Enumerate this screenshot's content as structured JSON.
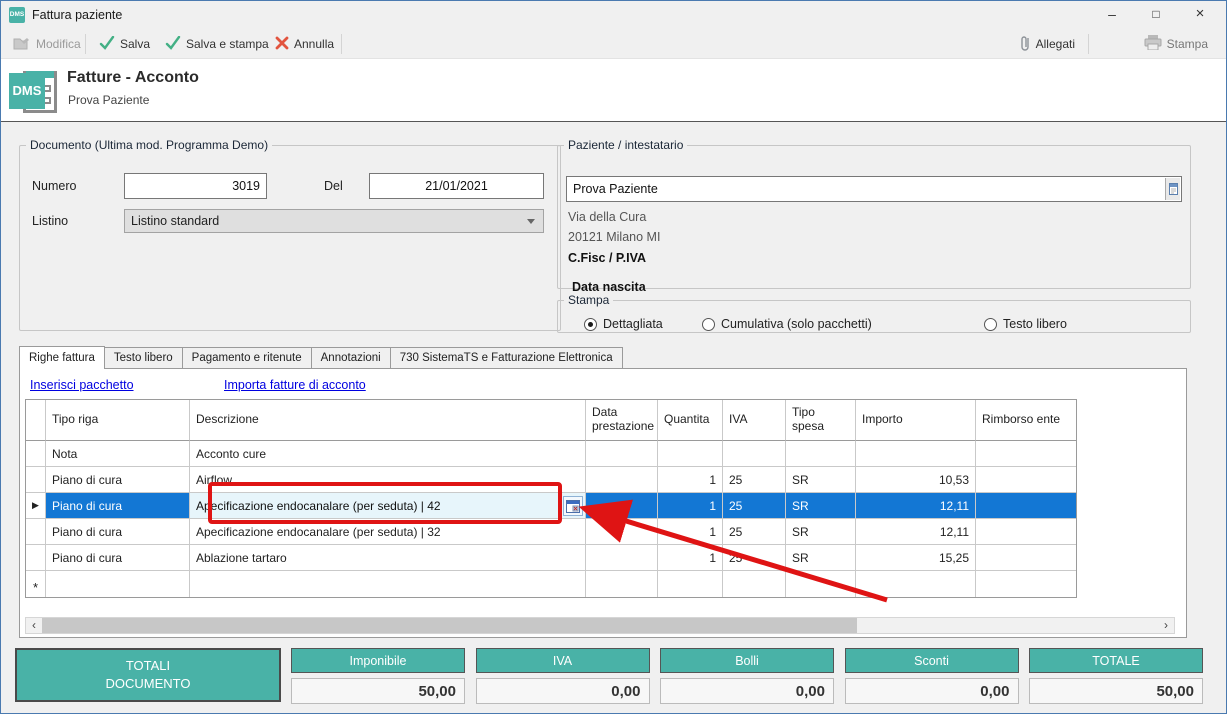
{
  "window": {
    "title": "Fattura paziente",
    "controls": {
      "minimize": "–",
      "maximize": "□",
      "close": "×"
    }
  },
  "toolbar": {
    "modifica": "Modifica",
    "salva": "Salva",
    "salva_e_stampa": "Salva e stampa",
    "annulla": "Annulla",
    "allegati": "Allegati",
    "stampa": "Stampa"
  },
  "header": {
    "logo_text": "DMS",
    "title": "Fatture - Acconto",
    "subtitle": "Prova Paziente"
  },
  "documento": {
    "legend": "Documento (Ultima mod. Programma Demo)",
    "numero_label": "Numero",
    "numero_value": "3019",
    "del_label": "Del",
    "del_value": "21/01/2021",
    "listino_label": "Listino",
    "listino_value": "Listino standard"
  },
  "paziente": {
    "legend": "Paziente / intestatario",
    "nome": "Prova Paziente",
    "indirizzo": "Via della Cura",
    "citta": "20121 Milano MI",
    "cfisc": "C.Fisc / P.IVA",
    "data_nascita": "Data nascita"
  },
  "stampa_group": {
    "legend": "Stampa",
    "options": [
      {
        "label": "Dettagliata",
        "selected": true
      },
      {
        "label": "Cumulativa (solo pacchetti)",
        "selected": false
      },
      {
        "label": "Testo libero",
        "selected": false
      }
    ]
  },
  "tabs": {
    "active_index": 0,
    "items": [
      {
        "label": "Righe fattura"
      },
      {
        "label": "Testo libero"
      },
      {
        "label": "Pagamento e ritenute"
      },
      {
        "label": "Annotazioni"
      },
      {
        "label": "730 SistemaTS e Fatturazione Elettronica"
      }
    ]
  },
  "links": {
    "inserisci": "Inserisci pacchetto",
    "importa": "Importa fatture di acconto"
  },
  "table": {
    "columns": [
      "",
      "Tipo riga",
      "Descrizione",
      "Data prestazione",
      "Quantita",
      "IVA",
      "Tipo spesa",
      "Importo",
      "Rimborso ente"
    ],
    "rows": [
      {
        "selector": "",
        "tipo_riga": "Nota",
        "descrizione": "Acconto cure",
        "data_prestazione": "",
        "quantita": "",
        "iva": "",
        "tipo_spesa": "",
        "importo": "",
        "rimborso_ente": "",
        "state": "normal"
      },
      {
        "selector": "",
        "tipo_riga": "Piano di cura",
        "descrizione": "Airflow",
        "data_prestazione": "",
        "quantita": "1",
        "iva": "25",
        "tipo_spesa": "SR",
        "importo": "10,53",
        "rimborso_ente": "",
        "state": "normal"
      },
      {
        "selector": "▶",
        "tipo_riga": "Piano di cura",
        "descrizione": "Apecificazione endocanalare (per seduta) | 42",
        "data_prestazione": "",
        "quantita": "1",
        "iva": "25",
        "tipo_spesa": "SR",
        "importo": "12,11",
        "rimborso_ente": "",
        "state": "selected"
      },
      {
        "selector": "",
        "tipo_riga": "Piano di cura",
        "descrizione": "Apecificazione endocanalare (per seduta) | 32",
        "data_prestazione": "",
        "quantita": "1",
        "iva": "25",
        "tipo_spesa": "SR",
        "importo": "12,11",
        "rimborso_ente": "",
        "state": "normal"
      },
      {
        "selector": "",
        "tipo_riga": "Piano di cura",
        "descrizione": "Ablazione tartaro",
        "data_prestazione": "",
        "quantita": "1",
        "iva": "25",
        "tipo_spesa": "SR",
        "importo": "15,25",
        "rimborso_ente": "",
        "state": "normal"
      },
      {
        "selector": "*",
        "tipo_riga": "",
        "descrizione": "",
        "data_prestazione": "",
        "quantita": "",
        "iva": "",
        "tipo_spesa": "",
        "importo": "",
        "rimborso_ente": "",
        "state": "new"
      }
    ]
  },
  "scrollbar": {
    "left_arrow": "‹",
    "right_arrow": "›"
  },
  "totals": {
    "label": "TOTALI\nDOCUMENTO",
    "items": [
      {
        "label": "Imponibile",
        "value": "50,00"
      },
      {
        "label": "IVA",
        "value": "0,00"
      },
      {
        "label": "Bolli",
        "value": "0,00"
      },
      {
        "label": "Sconti",
        "value": "0,00"
      },
      {
        "label": "TOTALE",
        "value": "50,00"
      }
    ]
  },
  "colors": {
    "teal": "#49b2a7",
    "selection_blue": "#1377d4",
    "annotation_red": "#df1414",
    "link_blue": "#0000e0",
    "check_green": "#43b085",
    "cancel_red": "#e2543e",
    "edit_cell_bg": "#e7f5fb",
    "window_border": "#4a7ab0"
  }
}
